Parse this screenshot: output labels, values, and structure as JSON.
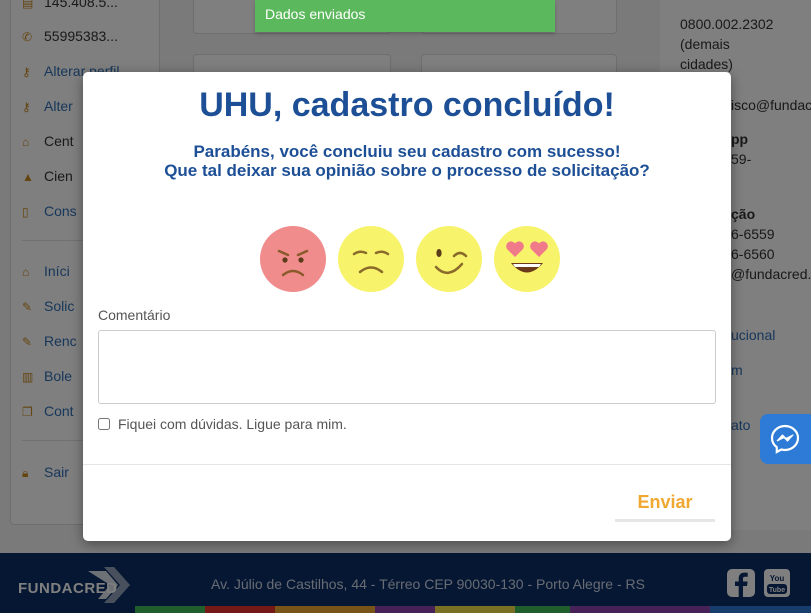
{
  "toast": {
    "message": "Dados enviados"
  },
  "sidebar": {
    "items": [
      {
        "label": "145.408.5...",
        "icon": "document-icon"
      },
      {
        "label": "55995383...",
        "icon": "phone-icon"
      },
      {
        "label": "Alterar perfil",
        "icon": "key-icon"
      },
      {
        "label": "Alter",
        "icon": "key-icon"
      },
      {
        "label": "Cent",
        "icon": "institution-icon"
      },
      {
        "label": "Cien",
        "icon": "graduation-cap-icon"
      },
      {
        "label": "Cons",
        "icon": "file-icon"
      },
      {
        "label": "Iníci",
        "icon": "home-icon"
      },
      {
        "label": "Solic",
        "icon": "edit-icon"
      },
      {
        "label": "Renc",
        "icon": "edit-icon"
      },
      {
        "label": "Bole",
        "icon": "barcode-icon"
      },
      {
        "label": "Cont",
        "icon": "copy-icon"
      },
      {
        "label": "Sair",
        "icon": "lock-icon"
      }
    ]
  },
  "right_panel": {
    "phone": "0800.002.2302",
    "phone_note_1": "(demais",
    "phone_note_2": "cidades)",
    "email_1": "isco@fundac",
    "whatsapp_label": "pp",
    "whatsapp_number": "59-",
    "section_label": "ção",
    "phone_a": "6-6559",
    "phone_b": "6-6560",
    "email_2": "@fundacred.c",
    "link_1": "ucional",
    "link_2": "m",
    "link_3": "ato"
  },
  "modal": {
    "title": "UHU, cadastro concluído!",
    "subtitle_line1": "Parabéns, você concluiu seu cadastro com sucesso!",
    "subtitle_line2": "Que tal deixar sua opinião sobre o processo de solicitação?",
    "ratings": [
      "angry-face-icon",
      "sad-face-icon",
      "winking-face-icon",
      "heart-eyes-face-icon"
    ],
    "comment_label": "Comentário",
    "comment_value": "",
    "callme_label": "Fiquei com dúvidas. Ligue para mim.",
    "send_label": "Enviar"
  },
  "footer": {
    "brand": "FUNDACRED",
    "address": "Av. Júlio de Castilhos, 44 - Térreo CEP 90030-130 - Porto Alegre - RS"
  },
  "colors": {
    "title_blue": "#1d4f96",
    "toast_green": "#5cb85c",
    "send_orange": "#f0a830",
    "footer_navy": "#0d2f66",
    "messenger_blue": "#2d7bd6"
  }
}
